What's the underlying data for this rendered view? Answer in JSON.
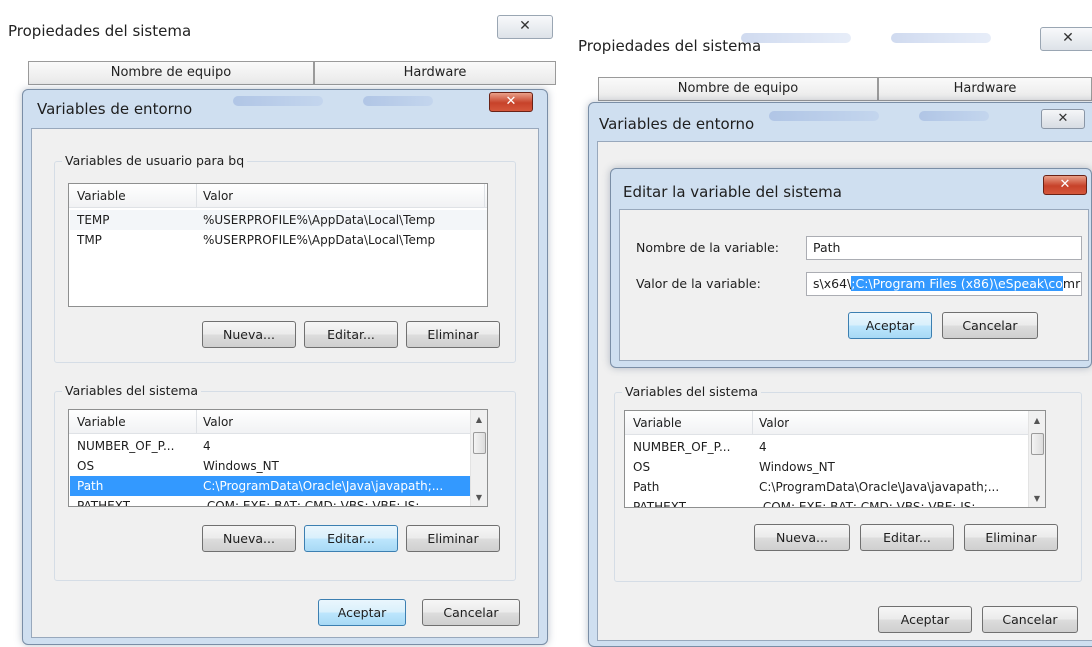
{
  "left": {
    "sys_title": "Propiedades del sistema",
    "close_glyph": "✕",
    "tabs": [
      "Nombre de equipo",
      "Hardware"
    ],
    "env": {
      "title": "Variables de entorno",
      "close_glyph": "✕",
      "user_group": {
        "label": "Variables de usuario para bq",
        "headers": [
          "Variable",
          "Valor"
        ],
        "rows": [
          {
            "variable": "TEMP",
            "valor": "%USERPROFILE%\\AppData\\Local\\Temp"
          },
          {
            "variable": "TMP",
            "valor": "%USERPROFILE%\\AppData\\Local\\Temp"
          }
        ],
        "buttons": [
          "Nueva...",
          "Editar...",
          "Eliminar"
        ]
      },
      "sys_group": {
        "label": "Variables del sistema",
        "headers": [
          "Variable",
          "Valor"
        ],
        "rows": [
          {
            "variable": "NUMBER_OF_P...",
            "valor": "4"
          },
          {
            "variable": "OS",
            "valor": "Windows_NT"
          },
          {
            "variable": "Path",
            "valor": "C:\\ProgramData\\Oracle\\Java\\javapath;..."
          },
          {
            "variable": "PATHEXT",
            "valor": ".COM;.EXE;.BAT;.CMD;.VBS;.VBE;.JS;...."
          }
        ],
        "selected_row": "Path",
        "buttons": [
          "Nueva...",
          "Editar...",
          "Eliminar"
        ]
      },
      "footer_buttons": [
        "Aceptar",
        "Cancelar"
      ]
    }
  },
  "right": {
    "sys_title": "Propiedades del sistema",
    "close_glyph": "✕",
    "tabs": [
      "Nombre de equipo",
      "Hardware"
    ],
    "env": {
      "title": "Variables de entorno",
      "close_glyph": "✕",
      "sys_group": {
        "label": "Variables del sistema",
        "headers": [
          "Variable",
          "Valor"
        ],
        "rows": [
          {
            "variable": "NUMBER_OF_P...",
            "valor": "4"
          },
          {
            "variable": "OS",
            "valor": "Windows_NT"
          },
          {
            "variable": "Path",
            "valor": "C:\\ProgramData\\Oracle\\Java\\javapath;..."
          },
          {
            "variable": "PATHEXT",
            "valor": ".COM;.EXE;.BAT;.CMD;.VBS;.VBE;.JS;...."
          }
        ],
        "buttons": [
          "Nueva...",
          "Editar...",
          "Eliminar"
        ]
      },
      "footer_buttons": [
        "Aceptar",
        "Cancelar"
      ]
    },
    "edit_dialog": {
      "title": "Editar la variable del sistema",
      "close_glyph": "✕",
      "name_label": "Nombre de la variable:",
      "name_value": "Path",
      "value_label": "Valor de la variable:",
      "value_prefix": "s\\x64\\",
      "value_selected": ";C:\\Program Files (x86)\\eSpeak\\co",
      "value_suffix": "mr",
      "buttons": [
        "Aceptar",
        "Cancelar"
      ]
    }
  },
  "colors": {
    "selection": "#3399ff",
    "close_red": "#c7422a",
    "dialog_frame": "#cfdff0"
  }
}
